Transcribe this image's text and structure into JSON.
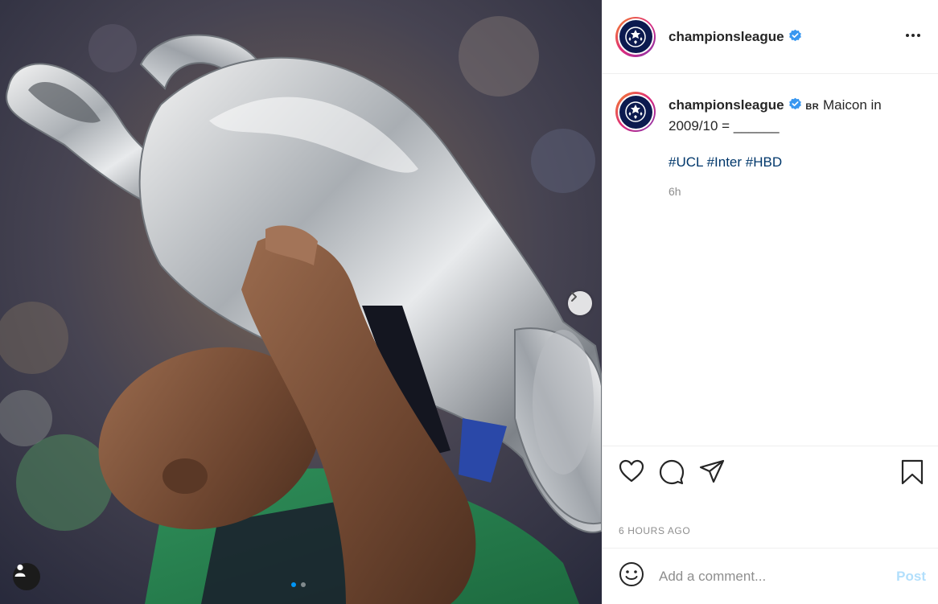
{
  "post": {
    "username": "championsleague",
    "verified": true,
    "caption": {
      "flag": "BR",
      "text": "Maicon in 2009/10 = ______",
      "hashtags": [
        "#UCL",
        "#Inter",
        "#HBD"
      ],
      "relative_time": "6h"
    },
    "timestamp": "6 HOURS AGO",
    "media": {
      "carousel_slides": 2,
      "active_slide": 1
    }
  },
  "comment_box": {
    "placeholder": "Add a comment...",
    "post_label": "Post"
  },
  "colors": {
    "verified_blue": "#3897f0",
    "hashtag": "#00376b",
    "post_disabled": "#b2dffc",
    "badge_navy": "#0c1a4f"
  },
  "icons": {
    "heart": "heart-icon",
    "comment": "comment-icon",
    "share": "share-icon",
    "save": "bookmark-icon",
    "emoji": "emoji-icon",
    "more": "more-options-icon",
    "next": "chevron-right-icon",
    "tag": "user-tag-icon"
  }
}
